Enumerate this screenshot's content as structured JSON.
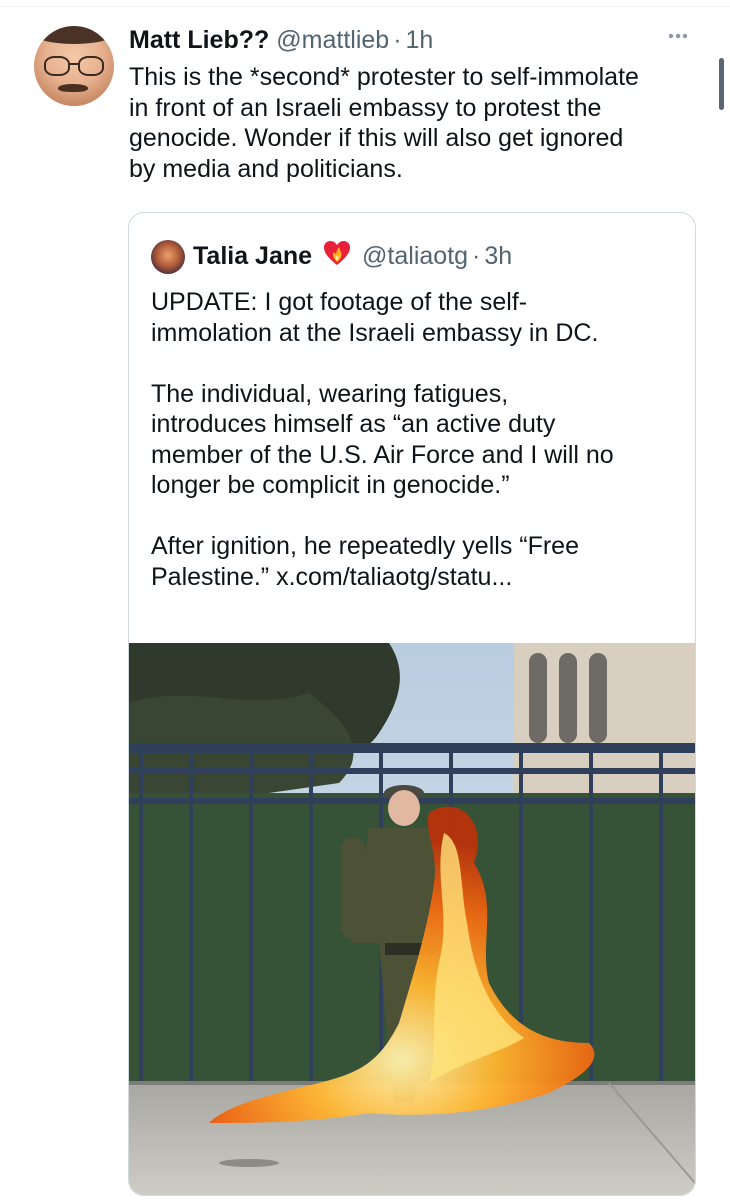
{
  "tweet": {
    "author_name": "Matt Lieb??",
    "author_handle": "@mattlieb",
    "separator": "·",
    "time": "1h",
    "more_icon": "more-horizontal-icon",
    "text": "This is the *second* protester to self-immolate\nin front of an Israeli embassy to protest the\ngenocide. Wonder if this will also get ignored\nby media and politicians."
  },
  "quoted": {
    "author_name": "Talia Jane",
    "badge_icon": "heart-on-fire-emoji",
    "author_handle": "@taliaotg",
    "separator": "·",
    "time": "3h",
    "text": "UPDATE: I got footage of the self-\nimmolation at the Israeli embassy in DC.\n\nThe individual, wearing fatigues,\nintroduces himself as “an active duty\nmember of the U.S. Air Force and I will no\nlonger be complicit in genocide.”\n\nAfter ignition, he repeatedly yells “Free\nPalestine.” ",
    "link_text": "x.com/taliaotg/statu..."
  },
  "colors": {
    "text_primary": "#0f1419",
    "text_secondary": "#536471",
    "border": "#cfd9de"
  }
}
